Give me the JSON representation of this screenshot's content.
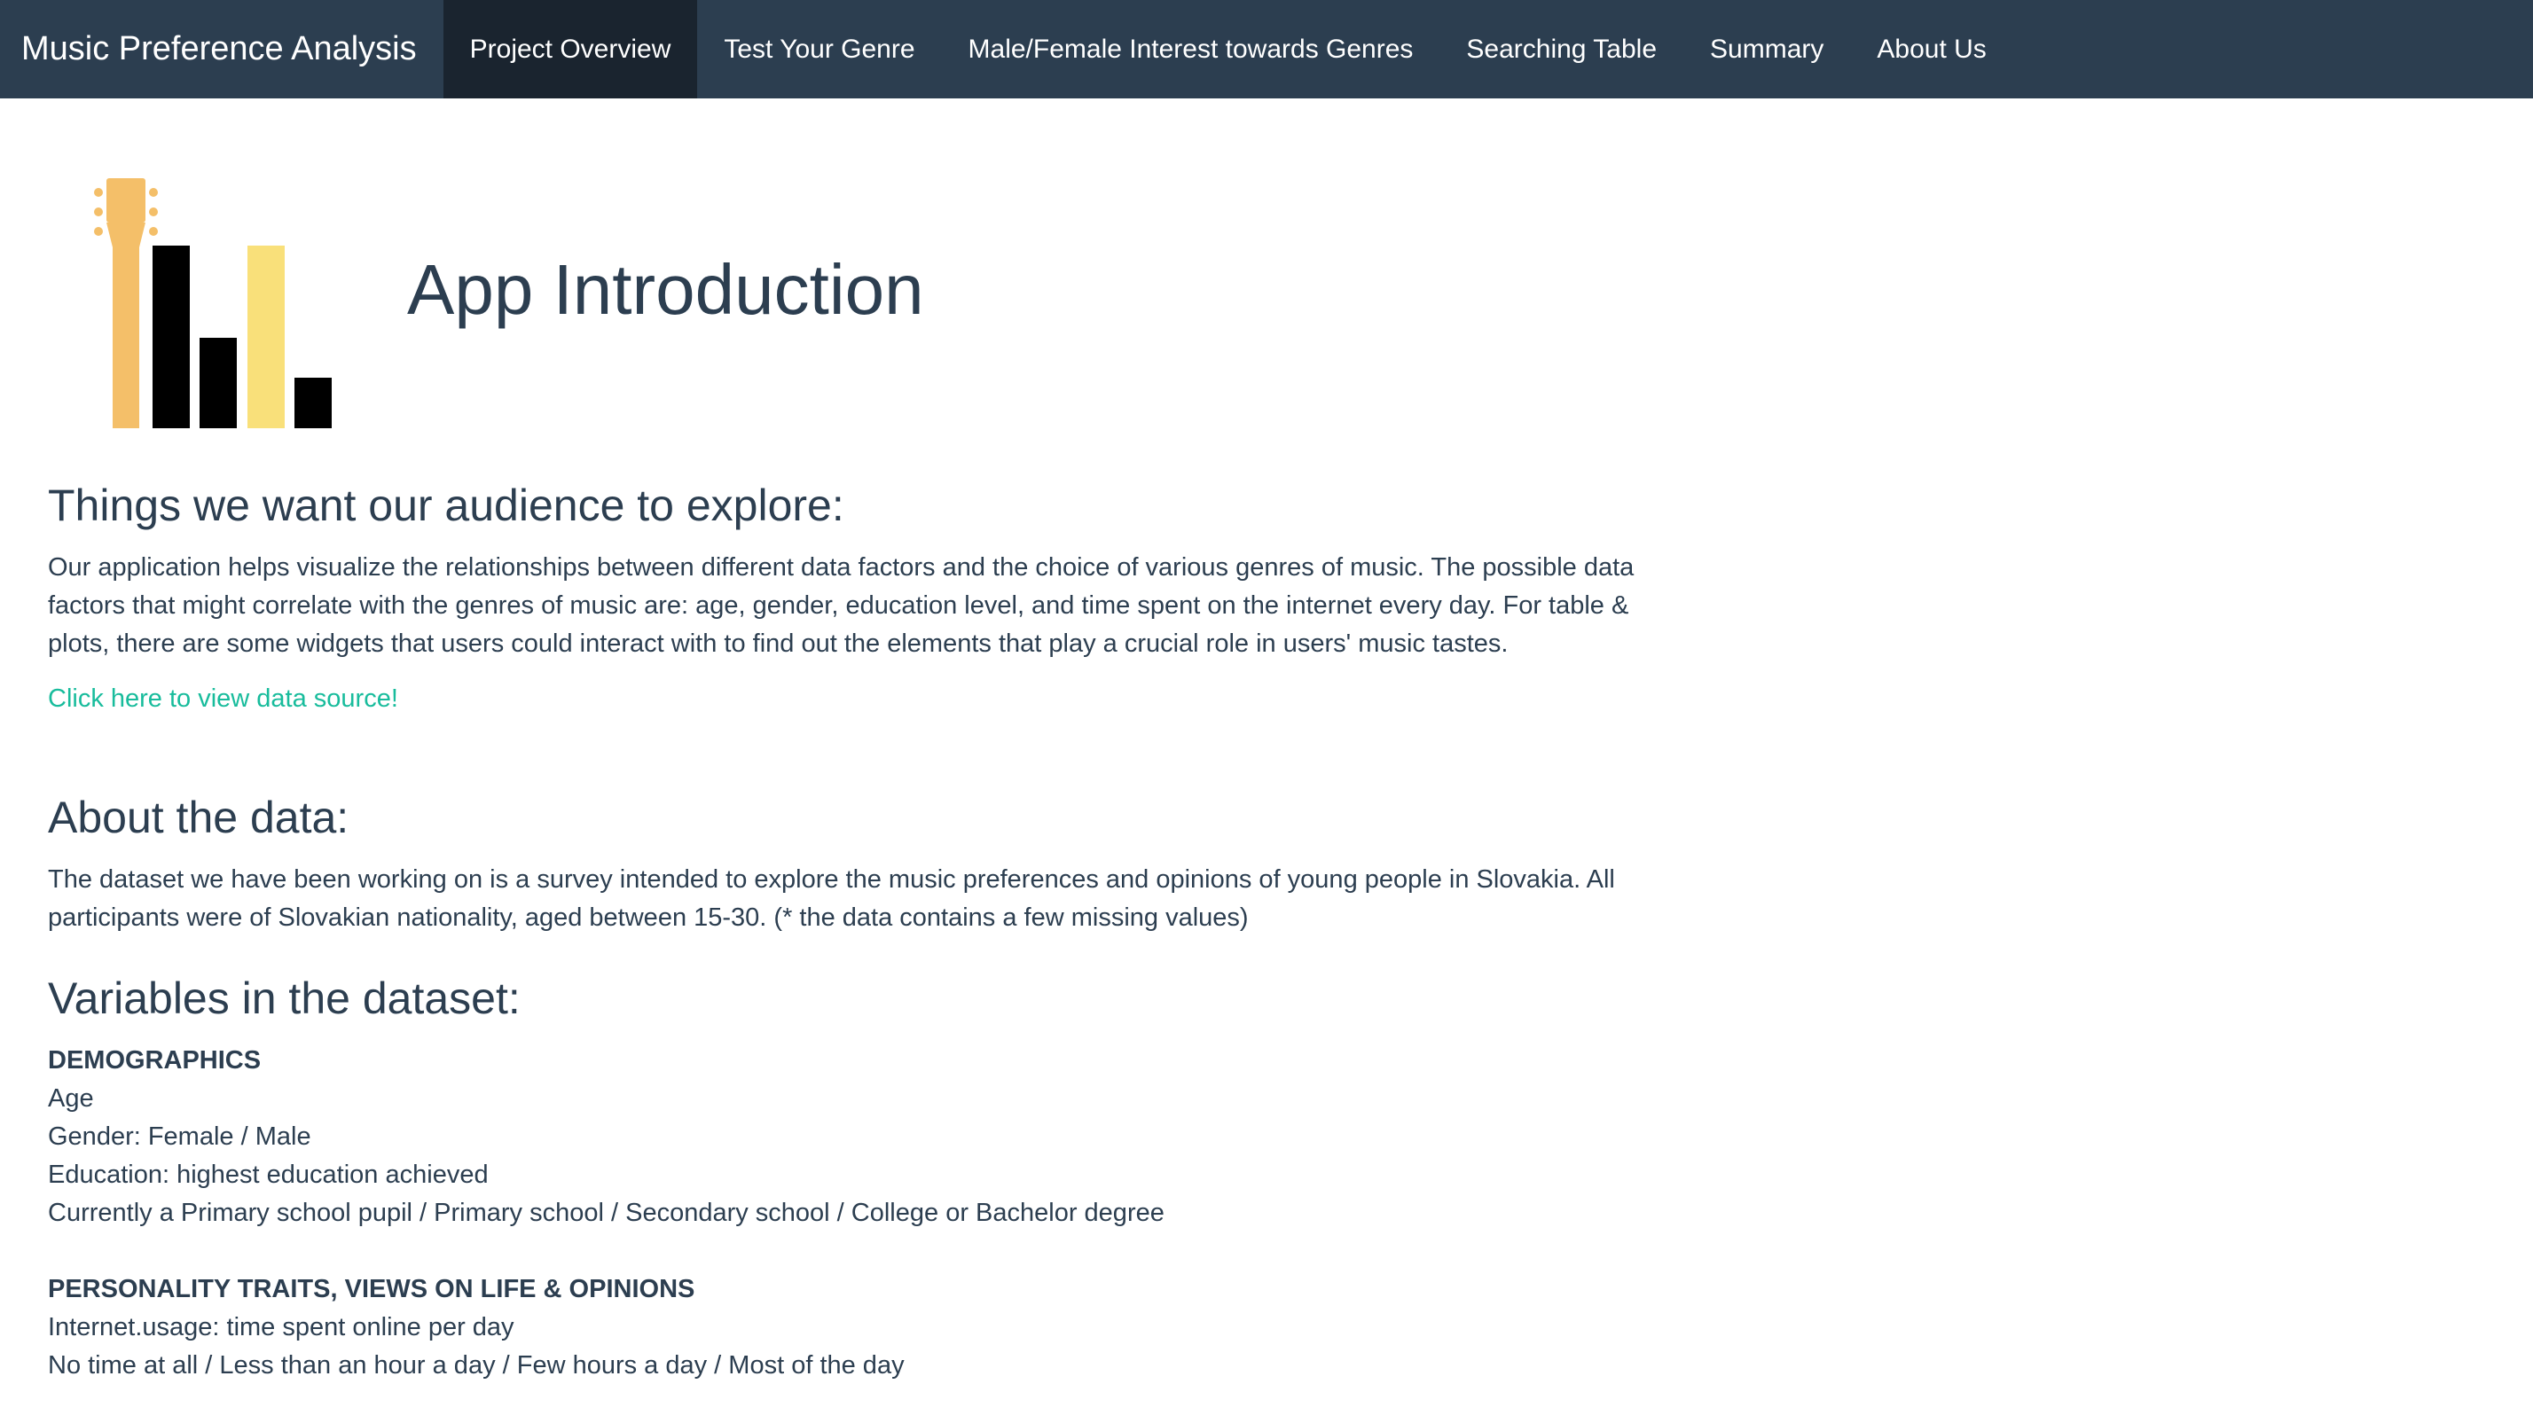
{
  "navbar": {
    "brand": "Music Preference Analysis",
    "tabs": [
      {
        "label": "Project Overview",
        "active": true
      },
      {
        "label": "Test Your Genre",
        "active": false
      },
      {
        "label": "Male/Female Interest towards Genres",
        "active": false
      },
      {
        "label": "Searching Table",
        "active": false
      },
      {
        "label": "Summary",
        "active": false
      },
      {
        "label": "About Us",
        "active": false
      }
    ]
  },
  "hero": {
    "title": "App Introduction"
  },
  "explore": {
    "heading": "Things we want our audience to explore:",
    "body": "Our application helps visualize the relationships between different data factors and the choice of various genres of music. The possible data factors that might correlate with the genres of music are: age, gender, education level, and time spent on the internet every day. For table & plots, there are some widgets that users could interact with to find out the elements that play a crucial role in users' music tastes.",
    "link": "Click here to view data source!"
  },
  "about": {
    "heading": "About the data:",
    "body": "The dataset we have been working on is a survey intended to explore the music preferences and opinions of young people in Slovakia. All participants were of Slovakian nationality, aged between 15-30. (* the data contains a few missing values)"
  },
  "variables": {
    "heading": "Variables in the dataset:",
    "groups": [
      {
        "title": "DEMOGRAPHICS",
        "lines": [
          "Age",
          "Gender: Female / Male",
          "Education: highest education achieved",
          "Currently a Primary school pupil / Primary school / Secondary school / College or Bachelor degree"
        ]
      },
      {
        "title": "PERSONALITY TRAITS, VIEWS ON LIFE & OPINIONS",
        "lines": [
          "Internet.usage: time spent online per day",
          "No time at all / Less than an hour a day / Few hours a day / Most of the day"
        ]
      }
    ]
  },
  "colors": {
    "navbar_bg": "#2c3e50",
    "navbar_active": "#1a242f",
    "text": "#2c3e50",
    "link": "#18bc9c",
    "guitar": "#f4bf69",
    "bar_yellow": "#f9e07a",
    "bar_black": "#000000"
  }
}
